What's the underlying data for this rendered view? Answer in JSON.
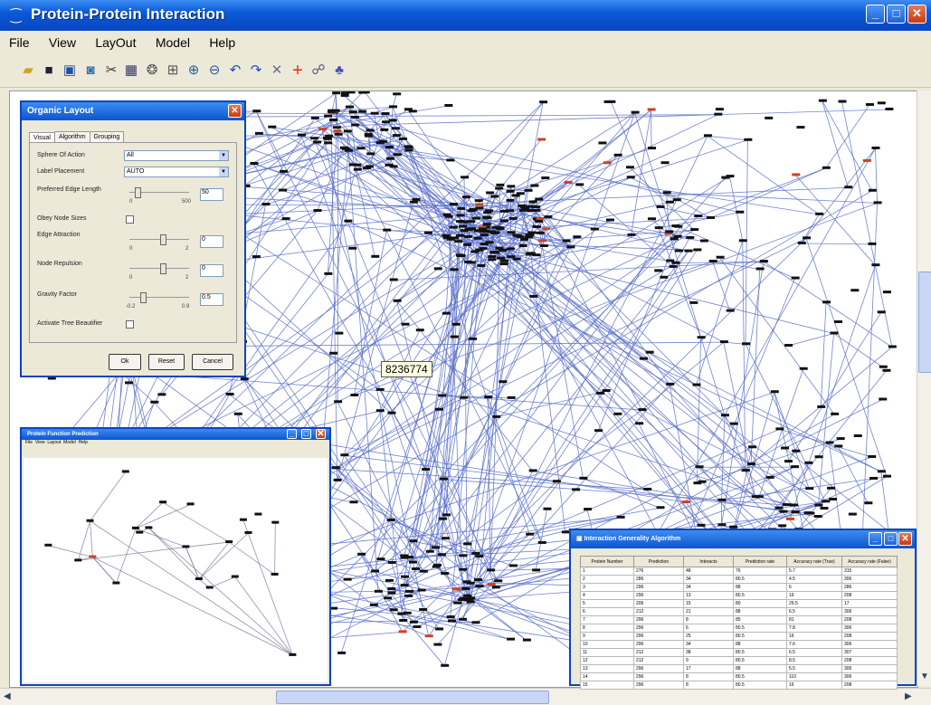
{
  "window": {
    "title": "Protein-Protein Interaction"
  },
  "menu": [
    "File",
    "View",
    "LayOut",
    "Model",
    "Help"
  ],
  "toolbar_icons": [
    "open-folder-icon",
    "save-icon",
    "export-icon",
    "refresh-icon",
    "cut-icon",
    "grid-icon",
    "circle-layout-icon",
    "organic-layout-icon",
    "zoom-in-icon",
    "zoom-out-icon",
    "undo-icon",
    "redo-icon",
    "fit-icon",
    "crosshair-icon",
    "select-tool-icon",
    "hierarchy-icon"
  ],
  "tooltip": "8236774",
  "organic_layout": {
    "title": "Organic Layout",
    "tabs": [
      "Visual",
      "Algorithm",
      "Grouping"
    ],
    "fields": [
      {
        "label": "Sphere Of Action",
        "value": "All"
      },
      {
        "label": "Label Placement",
        "value": "AUTO"
      },
      {
        "label": "Preferred Edge Length",
        "value": "50",
        "min": "0",
        "max": "500"
      },
      {
        "label": "Obey Node Sizes",
        "value": ""
      },
      {
        "label": "Edge Attraction",
        "value": "0",
        "min": "0",
        "max": "2"
      },
      {
        "label": "Node Repulsion",
        "value": "0",
        "min": "0",
        "max": "2"
      },
      {
        "label": "Gravity Factor",
        "value": "0.5",
        "min": "-0.2",
        "max": "0.9"
      },
      {
        "label": "Activate Tree Beautifier",
        "value": ""
      }
    ],
    "buttons": [
      "Ok",
      "Reset",
      "Cancel"
    ]
  },
  "subnet": {
    "title": "Protein Function Prediction",
    "menu": [
      "File",
      "View",
      "Layout",
      "Model",
      "Help"
    ]
  },
  "interaction": {
    "title": "Interaction Generality Algorithm",
    "columns": [
      "Protein Number",
      "Prediction",
      "Interacts",
      "Prediction rate",
      "Accuracy rate (True)",
      "Accuracy rate (False)"
    ],
    "rows": [
      [
        "1",
        "276",
        "48",
        "76",
        "5.7",
        "315"
      ],
      [
        "2",
        "286",
        "34",
        "80.5",
        "4.5",
        "306"
      ],
      [
        "3",
        "296",
        "34",
        "88",
        "6",
        "286"
      ],
      [
        "4",
        "296",
        "13",
        "80.5",
        "16",
        "208"
      ],
      [
        "5",
        "206",
        "15",
        "80",
        "29.5",
        "17"
      ],
      [
        "6",
        "212",
        "21",
        "88",
        "6.5",
        "306"
      ],
      [
        "7",
        "296",
        "8",
        "85",
        "81",
        "208"
      ],
      [
        "8",
        "296",
        "6",
        "80.5",
        "7.8",
        "306"
      ],
      [
        "9",
        "296",
        "25",
        "80.5",
        "16",
        "208"
      ],
      [
        "10",
        "296",
        "34",
        "88",
        "7.6",
        "306"
      ],
      [
        "11",
        "212",
        "38",
        "80.5",
        "6.5",
        "307"
      ],
      [
        "12",
        "212",
        "9",
        "80.5",
        "8.5",
        "208"
      ],
      [
        "13",
        "296",
        "17",
        "88",
        "5.5",
        "306"
      ],
      [
        "14",
        "296",
        "8",
        "80.5",
        "110",
        "306"
      ],
      [
        "15",
        "296",
        "8",
        "80.5",
        "16",
        "208"
      ]
    ]
  },
  "colors": {
    "edge": "#5a6fc8",
    "node": "#111111",
    "highlight": "#d04020",
    "titlebar": "#0a5ad8"
  }
}
